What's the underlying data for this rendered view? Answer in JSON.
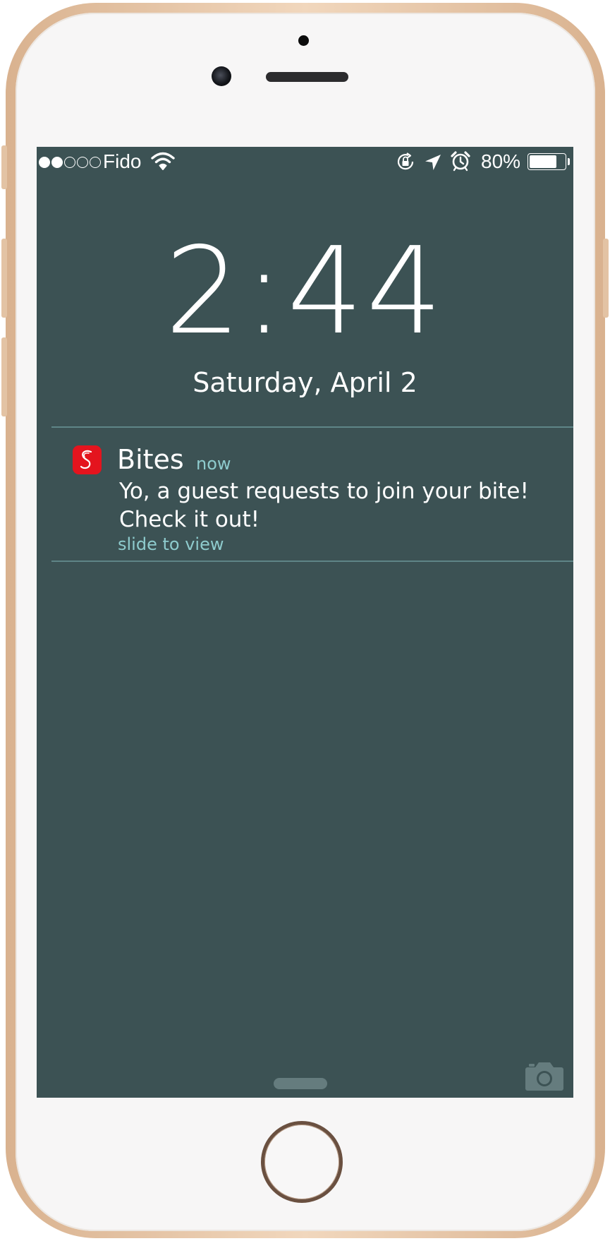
{
  "status_bar": {
    "signal_bars_filled": 2,
    "signal_bars_total": 5,
    "carrier": "Fido",
    "battery_percent": "80%",
    "battery_level": 0.8,
    "icons": [
      "wifi-icon",
      "rotation-lock-icon",
      "location-arrow-icon",
      "alarm-clock-icon",
      "battery-icon"
    ]
  },
  "lock_screen": {
    "time": "2:44",
    "date": "Saturday,  April 2"
  },
  "notification": {
    "app_name": "Bites",
    "app_icon": "bites-app-icon",
    "time": "now",
    "message": "Yo, a guest requests to join your bite! Check it out!",
    "action": "slide to view"
  },
  "bottom": {
    "camera_icon": "camera-icon"
  },
  "colors": {
    "screen_background": "#3c5254",
    "accent_text": "#8ecbcd",
    "app_icon_red": "#e4141e",
    "divider": "#5f8587",
    "frame_gold": "#e3c3a4"
  }
}
